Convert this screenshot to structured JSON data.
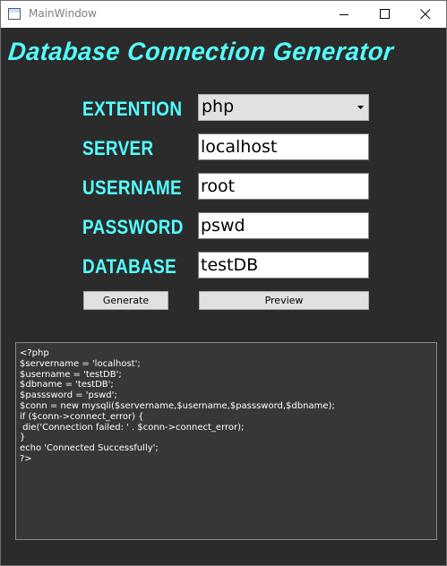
{
  "window": {
    "title": "MainWindow",
    "minimize_icon": "minimize-icon",
    "maximize_icon": "maximize-icon",
    "close_icon": "close-icon"
  },
  "heading": "Database Connection Generator",
  "form": {
    "extension_label": "EXTENTION",
    "extension_value": "php",
    "server_label": "SERVER",
    "server_value": "localhost",
    "username_label": "USERNAME",
    "username_value": "root",
    "password_label": "PASSWORD",
    "password_value": "pswd",
    "database_label": "DATABASE",
    "database_value": "testDB"
  },
  "buttons": {
    "generate": "Generate",
    "preview": "Preview"
  },
  "output": {
    "code": "<?php\n$servername = 'localhost';\n$username = 'testDB';\n$dbname = 'testDB';\n$passsword = 'pswd';\n$conn = new mysqli($servername,$username,$passsword,$dbname);\nif ($conn->connect_error) {\n die('Connection failed: ' . $conn->connect_error);\n}\necho 'Connected Successfully';\n?>"
  },
  "colors": {
    "accent": "#55ffff",
    "background": "#2b2b2b",
    "output_background": "#373737"
  }
}
